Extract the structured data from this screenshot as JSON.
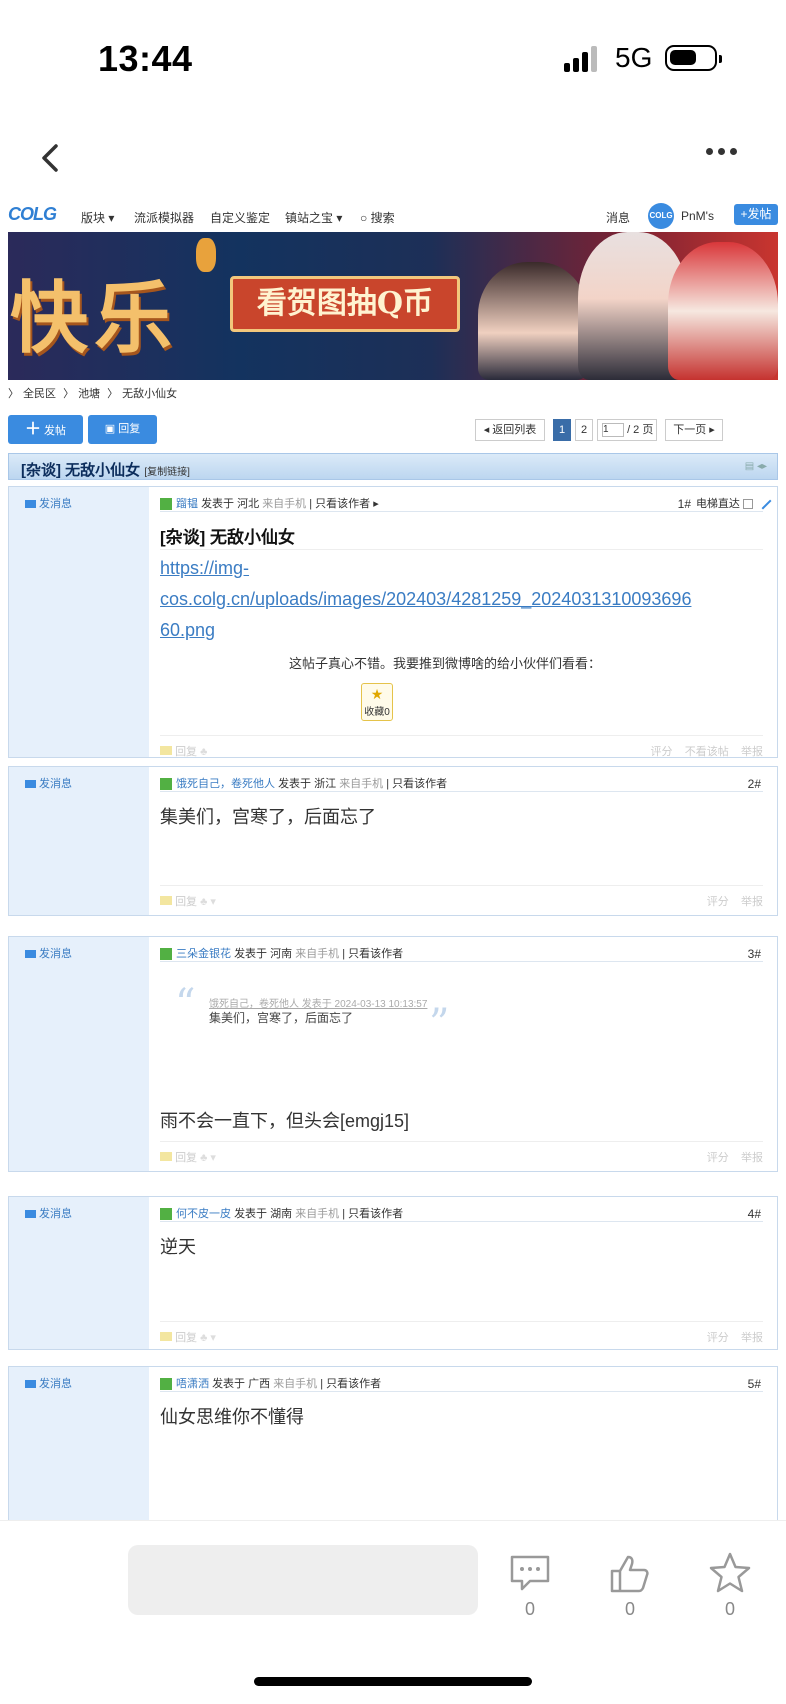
{
  "status_bar": {
    "time": "13:44",
    "network": "5G"
  },
  "site": {
    "logo": "COLG",
    "nav": [
      "版块",
      "流派模拟器",
      "自定义鉴定",
      "镇站之宝",
      "搜索"
    ],
    "right": {
      "messages": "消息",
      "avatar_text": "COLG",
      "username": "PnM's",
      "post_button": "+发帖"
    },
    "banner": {
      "big_text": "快乐",
      "button_text": "看贺图抽Q币"
    },
    "breadcrumb": [
      "全民区",
      "池塘",
      "无敌小仙女"
    ],
    "actions": {
      "new_post": "发帖",
      "reply": "回复"
    },
    "pager": {
      "back_to_list": "返回列表",
      "pages": [
        "1",
        "2"
      ],
      "page_input": "1",
      "total_pages": "/ 2 页",
      "next": "下一页"
    },
    "thread_title": "[杂谈] 无敌小仙女",
    "copy_link": "[复制链接]"
  },
  "posts": [
    {
      "send_msg": "发消息",
      "user": "蹓韫",
      "posted_in": "发表于 河北",
      "device": "来自手机",
      "only_author": "只看该作者",
      "floor": "1#",
      "floor_extra": "电梯直达",
      "title": "[杂谈] 无敌小仙女",
      "link_lines": [
        "https://img-",
        "cos.colg.cn/uploads/images/202403/4281259_2024031310093696",
        "60.png"
      ],
      "share_text": "这帖子真心不错。我要推到微博啥的给小伙伴们看看：",
      "fav_label": "收藏0",
      "footer_left": "回复",
      "footer_right": [
        "评分",
        "不看该帖",
        "举报"
      ]
    },
    {
      "send_msg": "发消息",
      "user": "饿死自己，卷死他人",
      "posted_in": "发表于 浙江",
      "device": "来自手机",
      "only_author": "只看该作者",
      "floor": "2#",
      "body": "集美们，宫寒了，后面忘了",
      "footer_left": "回复",
      "footer_right": [
        "评分",
        "举报"
      ]
    },
    {
      "send_msg": "发消息",
      "user": "三朵金银花",
      "posted_in": "发表于 河南",
      "device": "来自手机",
      "only_author": "只看该作者",
      "floor": "3#",
      "quote_head": "饿死自己，卷死他人 发表于 2024-03-13 10:13:57",
      "quote_body": "集美们，宫寒了，后面忘了",
      "body": "雨不会一直下，但头会[emgj15]",
      "footer_left": "回复",
      "footer_right": [
        "评分",
        "举报"
      ]
    },
    {
      "send_msg": "发消息",
      "user": "何不皮一皮",
      "posted_in": "发表于 湖南",
      "device": "来自手机",
      "only_author": "只看该作者",
      "floor": "4#",
      "body": "逆天",
      "footer_left": "回复",
      "footer_right": [
        "评分",
        "举报"
      ]
    },
    {
      "send_msg": "发消息",
      "user": "唔潇洒",
      "posted_in": "发表于 广西",
      "device": "来自手机",
      "only_author": "只看该作者",
      "floor": "5#",
      "body": "仙女思维你不懂得"
    }
  ],
  "bottom_bar": {
    "comments": "0",
    "likes": "0",
    "favorites": "0"
  },
  "colors": {
    "accent": "#3a8be0",
    "sidebar": "#e6f0fb",
    "title_bar": "#bcd6f0"
  }
}
